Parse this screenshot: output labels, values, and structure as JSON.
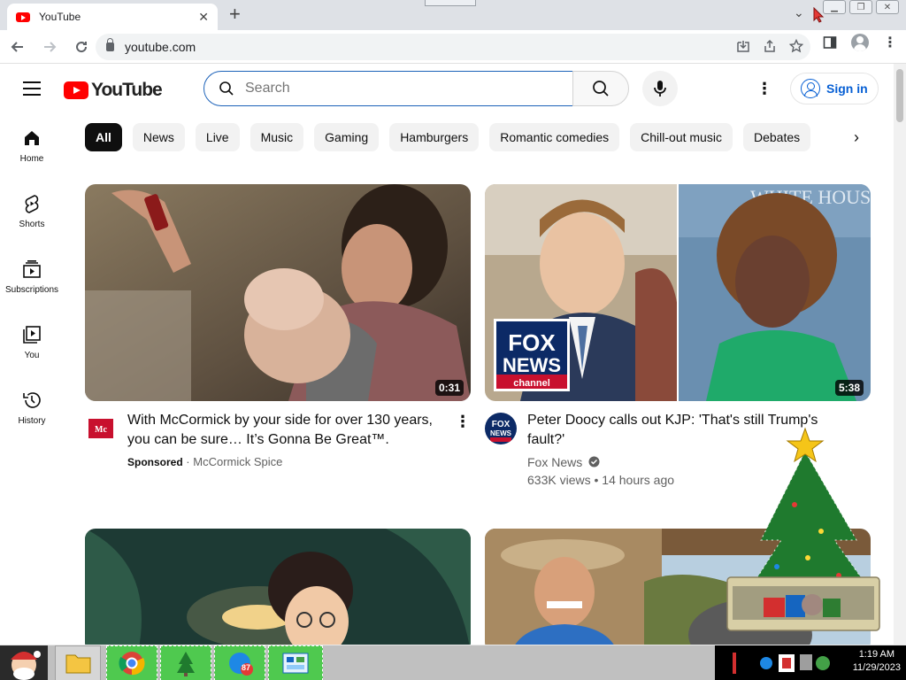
{
  "browser": {
    "tab_title": "YouTube",
    "tab_close": "✕",
    "new_tab": "+",
    "url": "youtube.com"
  },
  "header": {
    "logo_text": "YouTube",
    "search_placeholder": "Search",
    "signin_label": "Sign in"
  },
  "chips": [
    "All",
    "News",
    "Live",
    "Music",
    "Gaming",
    "Hamburgers",
    "Romantic comedies",
    "Chill-out music",
    "Debates"
  ],
  "leftnav": [
    {
      "label": "Home",
      "icon": "home-icon"
    },
    {
      "label": "Shorts",
      "icon": "shorts-icon"
    },
    {
      "label": "Subscriptions",
      "icon": "subscriptions-icon"
    },
    {
      "label": "You",
      "icon": "you-icon"
    },
    {
      "label": "History",
      "icon": "history-icon"
    }
  ],
  "videos": [
    {
      "title": "With McCormick by your side for over 130 years, you can be sure… It’s Gonna Be Great™.",
      "sponsored": "Sponsored",
      "channel": "McCormick Spice",
      "duration": "0:31",
      "channel_badge_text": "Mc"
    },
    {
      "title": "Peter Doocy calls out KJP: 'That's still Trump's fault?'",
      "channel": "Fox News",
      "views": "633K views",
      "age": "14 hours ago",
      "duration": "5:38",
      "logo_line1": "FOX",
      "logo_line2": "NEWS",
      "logo_line3": "channel",
      "backdrop_text": "WHITE HOUSE"
    }
  ],
  "taskbar": {
    "time": "1:19 AM",
    "date": "11/29/2023",
    "badge_count": "87"
  },
  "colors": {
    "youtube_red": "#ff0000",
    "link_blue": "#065fd4",
    "taskbar_green": "#4fc94f"
  }
}
